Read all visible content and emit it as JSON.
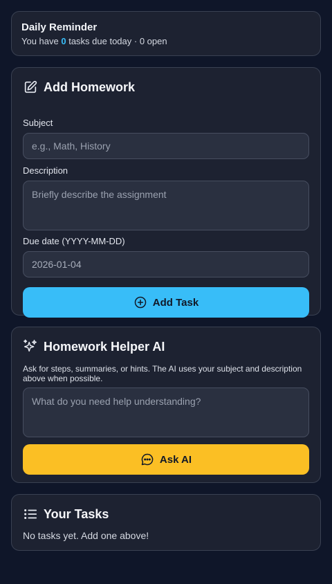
{
  "reminder": {
    "title": "Daily Reminder",
    "prefix": "You have ",
    "due_count": "0",
    "suffix": " tasks due today · 0 open"
  },
  "add_homework": {
    "title": "Add Homework",
    "icon": "edit-icon",
    "subject_label": "Subject",
    "subject_placeholder": "e.g., Math, History",
    "description_label": "Description",
    "description_placeholder": "Briefly describe the assignment",
    "due_label": "Due date (YYYY-MM-DD)",
    "due_value": "2026-01-04",
    "button_label": "Add Task",
    "button_icon": "plus-circle-icon"
  },
  "ai_helper": {
    "title": "Homework Helper AI",
    "icon": "sparkles-icon",
    "hint": "Ask for steps, summaries, or hints. The AI uses your subject and description above when possible.",
    "question_placeholder": "What do you need help understanding?",
    "button_label": "Ask AI",
    "button_icon": "chat-icon"
  },
  "tasks": {
    "title": "Your Tasks",
    "icon": "list-icon",
    "empty_message": "No tasks yet. Add one above!"
  },
  "colors": {
    "background": "#0f1629",
    "card": "#1d2231",
    "accent_blue": "#38bdf8",
    "accent_yellow": "#fbbf24"
  }
}
